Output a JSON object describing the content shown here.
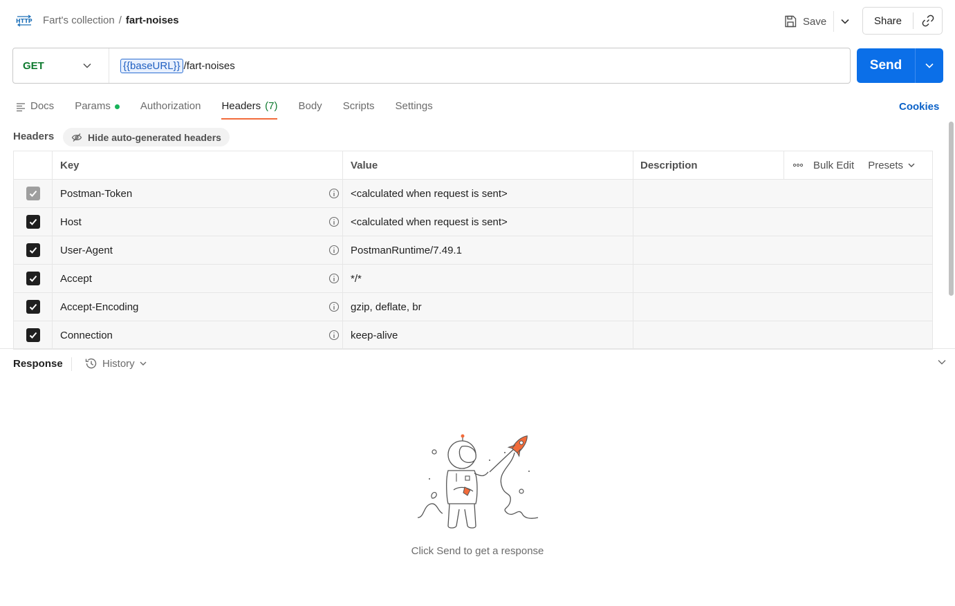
{
  "breadcrumb": {
    "collection": "Fart's collection",
    "separator": "/",
    "request": "fart-noises"
  },
  "toolbar": {
    "save_label": "Save",
    "share_label": "Share"
  },
  "request": {
    "method": "GET",
    "url_variable": "{{baseURL}}",
    "url_path": "/fart-noises",
    "send_label": "Send"
  },
  "tabs": [
    {
      "label": "Docs"
    },
    {
      "label": "Params"
    },
    {
      "label": "Authorization"
    },
    {
      "label": "Headers",
      "count": "(7)"
    },
    {
      "label": "Body"
    },
    {
      "label": "Scripts"
    },
    {
      "label": "Settings"
    }
  ],
  "cookies_label": "Cookies",
  "headers_section": {
    "title": "Headers",
    "hide_auto_label": "Hide auto-generated headers",
    "columns": {
      "key": "Key",
      "value": "Value",
      "description": "Description"
    },
    "bulk_edit_label": "Bulk Edit",
    "presets_label": "Presets",
    "rows": [
      {
        "key": "Postman-Token",
        "value": "<calculated when request is sent>",
        "checked": true,
        "disabled": true
      },
      {
        "key": "Host",
        "value": "<calculated when request is sent>",
        "checked": true,
        "disabled": false
      },
      {
        "key": "User-Agent",
        "value": "PostmanRuntime/7.49.1",
        "checked": true,
        "disabled": false
      },
      {
        "key": "Accept",
        "value": "*/*",
        "checked": true,
        "disabled": false
      },
      {
        "key": "Accept-Encoding",
        "value": "gzip, deflate, br",
        "checked": true,
        "disabled": false
      },
      {
        "key": "Connection",
        "value": "keep-alive",
        "checked": true,
        "disabled": false
      }
    ]
  },
  "response": {
    "title": "Response",
    "history_label": "History",
    "empty_message": "Click Send to get a response"
  },
  "colors": {
    "accent_send": "#0b6fe8",
    "method_get": "#0e7a2f",
    "active_tab_underline": "#f26b3a",
    "params_dot": "#18b35a",
    "link_blue": "#0b62c8"
  },
  "icons": {
    "app": "http-icon",
    "save": "save-icon",
    "link": "link-icon",
    "docs": "docs-icon",
    "hide": "eye-slash-icon",
    "info": "info-icon",
    "more": "more-horizontal-icon",
    "history": "history-icon"
  }
}
